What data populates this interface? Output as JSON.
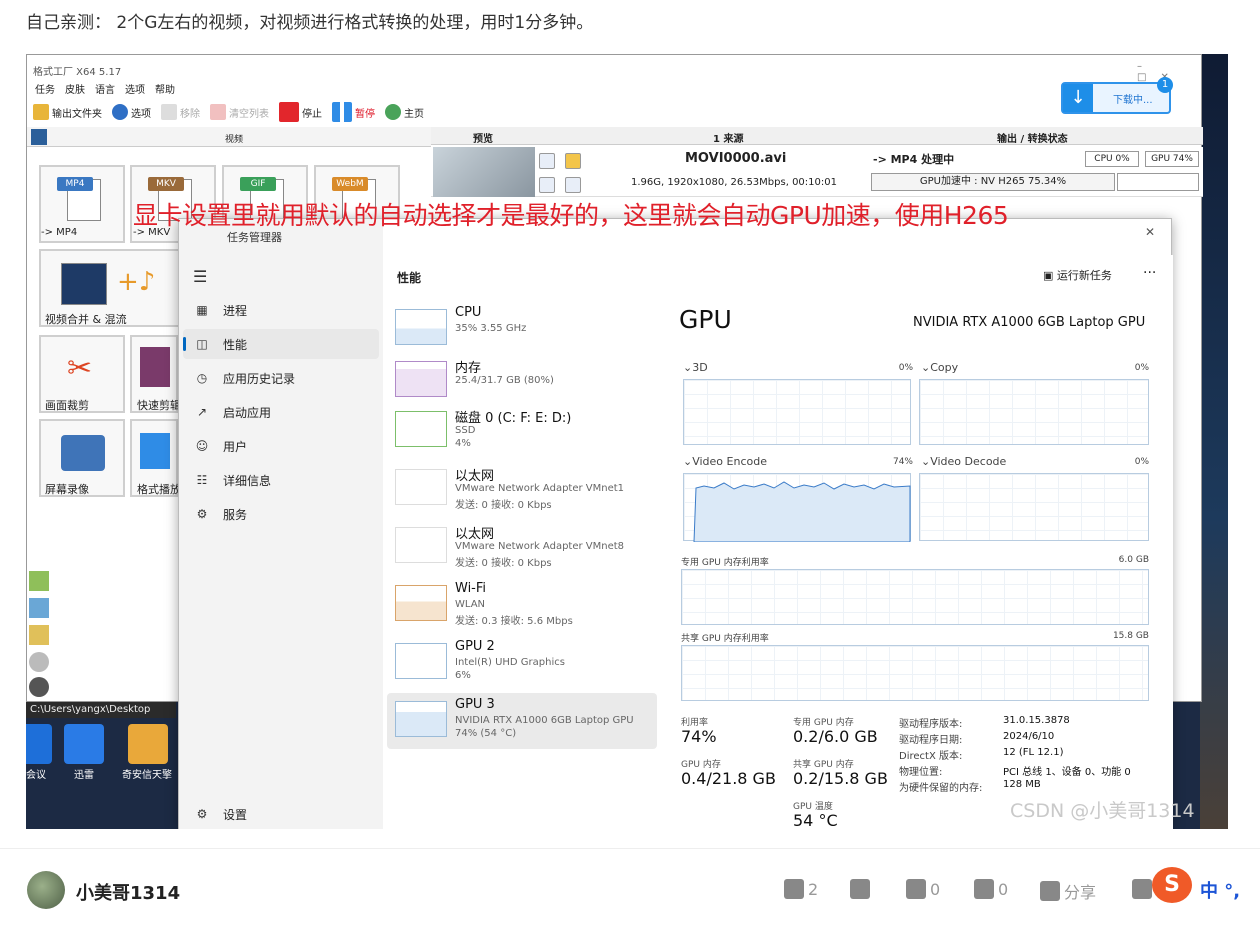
{
  "blog": {
    "caption": "自己亲测： 2个G左右的视频，对视频进行格式转换的处理，用时1分多钟。",
    "overlay_caption": "显卡设置里就用默认的自动选择才是最好的，这里就会自动GPU加速，使用H265",
    "watermark": "CSDN @小美哥1314",
    "author": "小美哥1314",
    "actions": {
      "like": "2",
      "star": "0",
      "comment": "0",
      "share": "分享"
    },
    "ime": "中 °,"
  },
  "format_factory": {
    "title": "格式工厂 X64 5.17",
    "menu": [
      "任务",
      "皮肤",
      "语言",
      "选项",
      "帮助"
    ],
    "toolbar": {
      "output_folder": "输出文件夹",
      "options": "选项",
      "remove": "移除",
      "clear": "清空列表",
      "stop": "停止",
      "pause": "暂停",
      "home": "主页"
    },
    "download": {
      "label": "下载中...",
      "badge": "1"
    },
    "left_header": "视频",
    "tiles": {
      "mp4_tag": "MP4",
      "mkv_tag": "MKV",
      "gif_tag": "GIF",
      "webm_tag": "WebM",
      "mp4_label": "-> MP4",
      "mkv_label": "-> MKV",
      "merge_label": "视频合并 & 混流",
      "crop_label": "画面裁剪",
      "quick_label": "快速剪辑",
      "record_label": "屏幕录像",
      "player_label": "格式播放"
    },
    "columns": {
      "preview": "预览",
      "source": "1 来源",
      "output": "输出 / 转换状态"
    },
    "task": {
      "filename": "MOVI0000.avi",
      "info": "1.96G, 1920x1080, 26.53Mbps, 00:10:01",
      "status": "-> MP4 处理中",
      "cpu": "CPU 0%",
      "gpu": "GPU 74%",
      "gpu_accel": "GPU加速中 : NV H265 75.34%"
    },
    "path": "C:\\Users\\yangx\\Desktop"
  },
  "desktop": {
    "icons": [
      "会议",
      "迅雷",
      "奇安信天擎"
    ]
  },
  "task_manager": {
    "title": "任务管理器",
    "nav": [
      "进程",
      "性能",
      "应用历史记录",
      "启动应用",
      "用户",
      "详细信息",
      "服务"
    ],
    "settings": "设置",
    "section": "性能",
    "run_task": "运行新任务",
    "devices": [
      {
        "name": "CPU",
        "l2": "35% 3.55 GHz",
        "l3": ""
      },
      {
        "name": "内存",
        "l2": "25.4/31.7 GB (80%)",
        "l3": ""
      },
      {
        "name": "磁盘 0 (C: F: E: D:)",
        "l2": "SSD",
        "l3": "4%"
      },
      {
        "name": "以太网",
        "l2": "VMware Network Adapter VMnet1",
        "l3": "发送: 0 接收: 0 Kbps"
      },
      {
        "name": "以太网",
        "l2": "VMware Network Adapter VMnet8",
        "l3": "发送: 0 接收: 0 Kbps"
      },
      {
        "name": "Wi-Fi",
        "l2": "WLAN",
        "l3": "发送: 0.3 接收: 5.6 Mbps"
      },
      {
        "name": "GPU 2",
        "l2": "Intel(R) UHD Graphics",
        "l3": "6%"
      },
      {
        "name": "GPU 3",
        "l2": "NVIDIA RTX A1000 6GB Laptop GPU",
        "l3": "74% (54 °C)"
      }
    ],
    "gpu": {
      "heading": "GPU",
      "model": "NVIDIA RTX A1000 6GB Laptop GPU",
      "engines": [
        {
          "name": "3D",
          "pct": "0%"
        },
        {
          "name": "Copy",
          "pct": "0%"
        },
        {
          "name": "Video Encode",
          "pct": "74%"
        },
        {
          "name": "Video Decode",
          "pct": "0%"
        }
      ],
      "dedicated_label": "专用 GPU 内存利用率",
      "dedicated_max": "6.0 GB",
      "shared_label": "共享 GPU 内存利用率",
      "shared_max": "15.8 GB",
      "stats": {
        "util_l": "利用率",
        "util_v": "74%",
        "ded_l": "专用 GPU 内存",
        "ded_v": "0.2/6.0 GB",
        "mem_l": "GPU 内存",
        "mem_v": "0.4/21.8 GB",
        "shr_l": "共享 GPU 内存",
        "shr_v": "0.2/15.8 GB",
        "temp_l": "GPU 温度",
        "temp_v": "54 °C"
      },
      "driver": [
        {
          "k": "驱动程序版本:",
          "v": "31.0.15.3878"
        },
        {
          "k": "驱动程序日期:",
          "v": "2024/6/10"
        },
        {
          "k": "DirectX 版本:",
          "v": "12 (FL 12.1)"
        },
        {
          "k": "物理位置:",
          "v": "PCI 总线 1、设备 0、功能 0"
        },
        {
          "k": "为硬件保留的内存:",
          "v": "128 MB"
        }
      ]
    }
  }
}
